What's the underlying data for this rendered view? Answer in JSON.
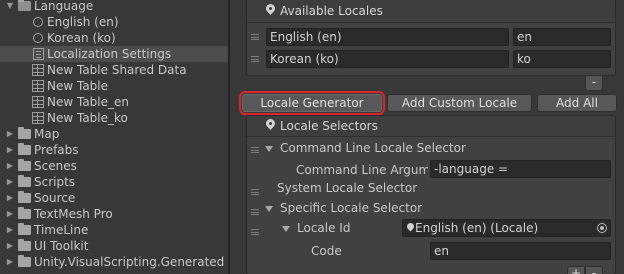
{
  "tree": {
    "items": [
      {
        "label": "Language"
      },
      {
        "label": "English (en)"
      },
      {
        "label": "Korean (ko)"
      },
      {
        "label": "Localization Settings"
      },
      {
        "label": "New Table Shared Data"
      },
      {
        "label": "New Table"
      },
      {
        "label": "New Table_en"
      },
      {
        "label": "New Table_ko"
      },
      {
        "label": "Map"
      },
      {
        "label": "Prefabs"
      },
      {
        "label": "Scenes"
      },
      {
        "label": "Scripts"
      },
      {
        "label": "Source"
      },
      {
        "label": "TextMesh Pro"
      },
      {
        "label": "TimeLine"
      },
      {
        "label": "UI Toolkit"
      },
      {
        "label": "Unity.VisualScripting.Generated"
      }
    ]
  },
  "inspector": {
    "available_locales": {
      "title": "Available Locales",
      "rows": [
        {
          "name": "English (en)",
          "code": "en"
        },
        {
          "name": "Korean (ko)",
          "code": "ko"
        }
      ],
      "remove_label": "-"
    },
    "buttons": {
      "locale_generator": "Locale Generator",
      "add_custom_locale": "Add Custom Locale",
      "add_all": "Add All"
    },
    "locale_selectors": {
      "title": "Locale Selectors",
      "command_line": {
        "title": "Command Line Locale Selector",
        "arg_label": "Command Line Argume",
        "arg_value": "-language ="
      },
      "system": {
        "title": "System Locale Selector"
      },
      "specific": {
        "title": "Specific Locale Selector",
        "locale_id_label": "Locale Id",
        "locale_id_value": "English (en) (Locale)",
        "code_label": "Code",
        "code_value": "en"
      },
      "add_label": "+",
      "remove_label": "-"
    }
  },
  "colors": {
    "highlight": "#d9262b",
    "background": "#383838",
    "panel": "#414141"
  }
}
